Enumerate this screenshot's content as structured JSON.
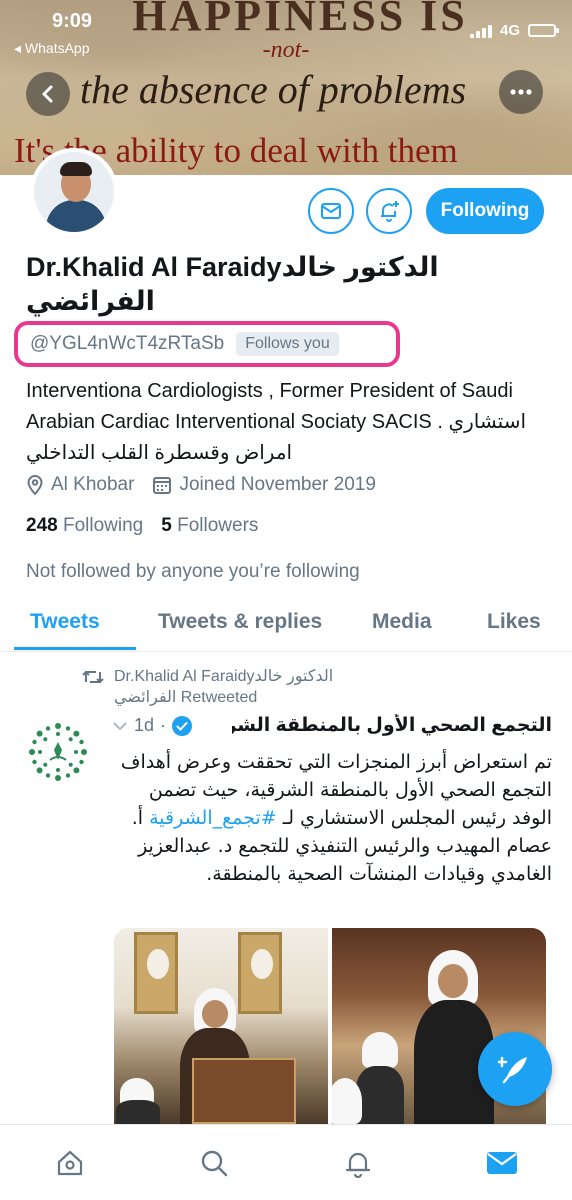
{
  "status_bar": {
    "time": "9:09",
    "back_app": "◂ WhatsApp",
    "network": "4G"
  },
  "banner": {
    "line1": "HAPPINESS IS",
    "line2": "-not-",
    "line3": "the absence of problems",
    "line4": "It's the ability to deal with them"
  },
  "profile": {
    "display_name": "Dr.Khalid Al Faraidyالدكتور خالد الفرائضي",
    "handle": "@YGL4nWcT4zRTaSb",
    "follows_you": "Follows you",
    "follow_button": "Following",
    "bio": "Interventiona Cardiologists , Former President of Saudi Arabian Cardiac Interventional Sociaty SACIS . استشاري امراض وقسطرة القلب التداخلي",
    "location": "Al Khobar",
    "joined": "Joined November 2019",
    "following_count": "248",
    "following_label": "Following",
    "followers_count": "5",
    "followers_label": "Followers",
    "not_followed": "Not followed by anyone you’re following"
  },
  "tabs": [
    {
      "label": "Tweets",
      "active": true
    },
    {
      "label": "Tweets & replies",
      "active": false
    },
    {
      "label": "Media",
      "active": false
    },
    {
      "label": "Likes",
      "active": false
    }
  ],
  "tweet": {
    "retweeted_by": "Dr.Khalid Al Faraidyالدكتور خالد الفرائضي Retweeted",
    "author": "التجمع الصحي الأول بالمنطقة الشر...",
    "time": "1d",
    "text_part1": "تم استعراض أبرز المنجزات التي تحققت وعرض أهداف التجمع الصحي الأول بالمنطقة الشرقية، حيث تضمن الوفد رئيس المجلس الاستشاري لـ ",
    "hashtag": "#تجمع_الشرقية",
    "text_part2": " أ. عصام المهيدب والرئيس التنفيذي للتجمع د. عبدالعزيز الغامدي وقيادات المنشآت الصحية بالمنطقة."
  },
  "icons": {
    "back": "chevron-left-icon",
    "more": "more-horizontal-icon",
    "message": "mail-icon",
    "notify": "bell-plus-icon",
    "location": "location-pin-icon",
    "calendar": "calendar-icon",
    "retweet": "retweet-icon",
    "verified": "verified-badge-icon",
    "caret": "chevron-down-icon",
    "compose": "compose-feather-icon",
    "nav": [
      "home-icon",
      "search-icon",
      "bell-icon",
      "mail-icon"
    ]
  },
  "colors": {
    "accent": "#1da1f2",
    "highlight": "#e8388f",
    "muted": "#657786"
  }
}
